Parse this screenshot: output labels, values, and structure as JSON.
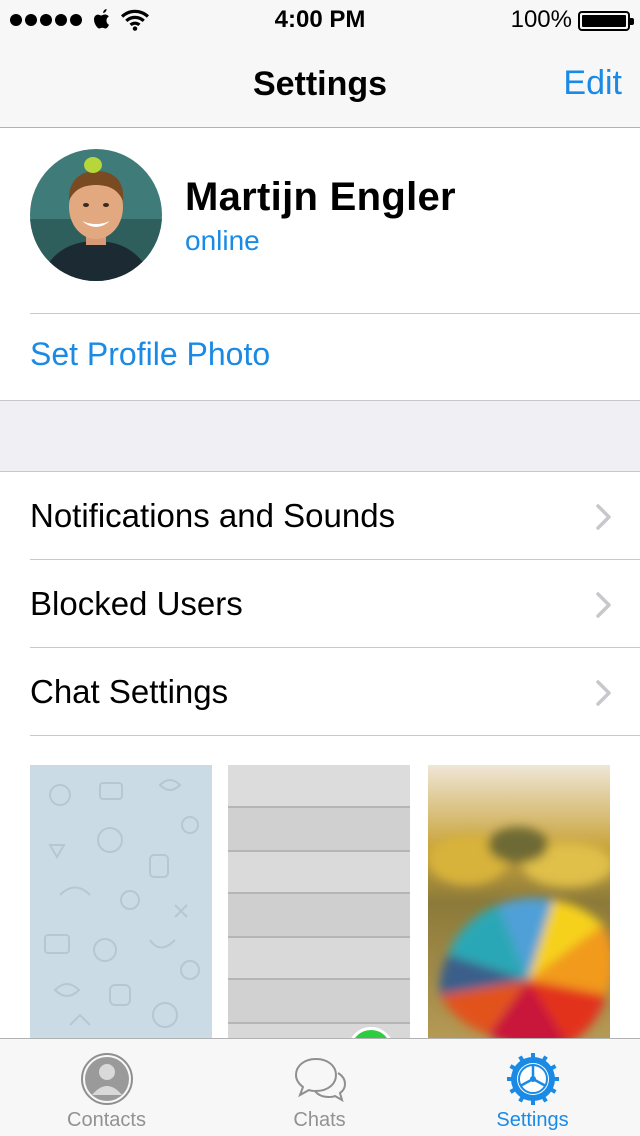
{
  "status_bar": {
    "time": "4:00 PM",
    "battery_percent": "100%",
    "battery_level": 1.0,
    "signal_bars": 5,
    "icons": [
      "signal-dots-icon",
      "carrier-icon",
      "wifi-icon",
      "battery-icon"
    ]
  },
  "nav": {
    "title": "Settings",
    "edit_label": "Edit"
  },
  "profile": {
    "name": "Martijn Engler",
    "status": "online",
    "set_photo_label": "Set Profile Photo"
  },
  "menu": [
    {
      "label": "Notifications and Sounds",
      "icon": "chevron-right-icon"
    },
    {
      "label": "Blocked Users",
      "icon": "chevron-right-icon"
    },
    {
      "label": "Chat Settings",
      "icon": "chevron-right-icon"
    }
  ],
  "wallpapers": [
    {
      "name": "doodle-pattern"
    },
    {
      "name": "gray-wood-planks"
    },
    {
      "name": "blurred-umbrella",
      "selected": true
    }
  ],
  "tabs": [
    {
      "label": "Contacts",
      "icon": "contacts-icon",
      "active": false
    },
    {
      "label": "Chats",
      "icon": "chats-icon",
      "active": false
    },
    {
      "label": "Settings",
      "icon": "settings-gear-icon",
      "active": true
    }
  ],
  "colors": {
    "accent": "#1a8ae5",
    "bar_background": "#f7f7f7",
    "separator": "#c8c7cc",
    "group_background": "#efeff4",
    "tab_inactive": "#929292",
    "selected_badge": "#2ecc40"
  }
}
